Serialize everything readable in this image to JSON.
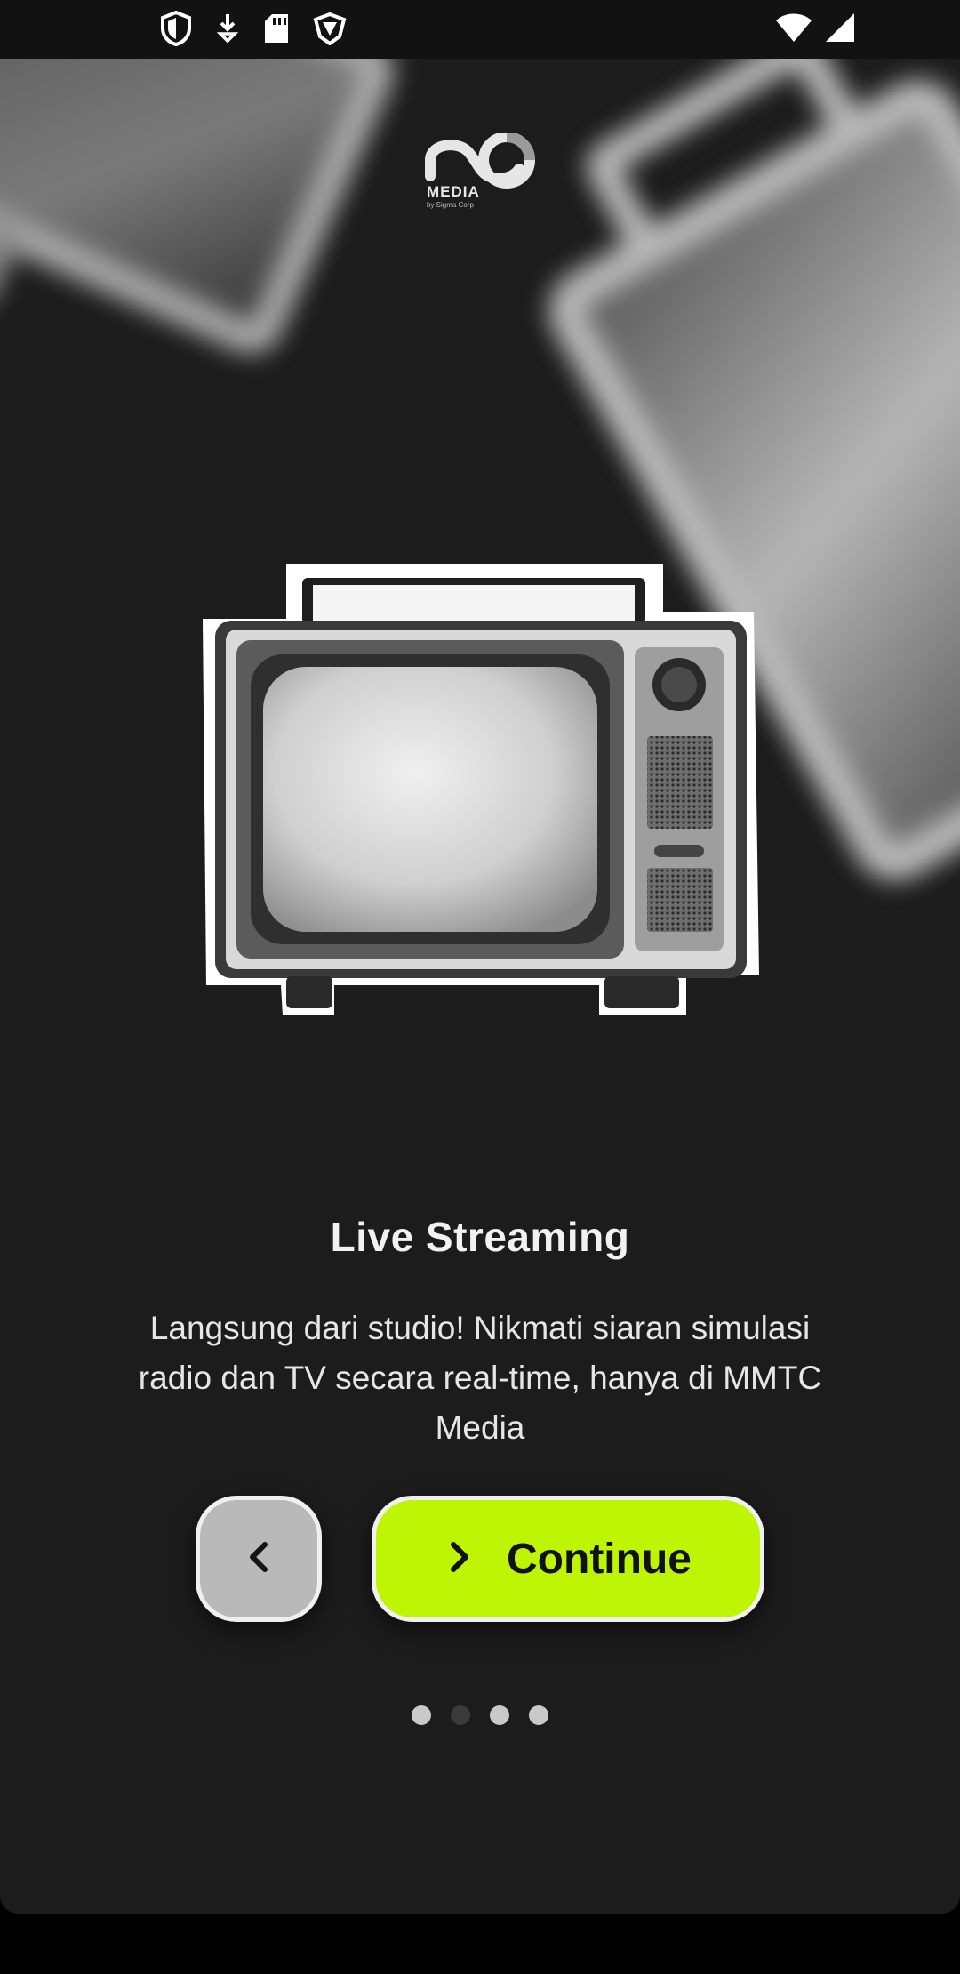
{
  "status_bar": {
    "left_icons": [
      "shield-icon",
      "download-icon",
      "sd-card-icon",
      "vpn-shield-icon"
    ],
    "right_icons": [
      "wifi-icon",
      "cell-signal-icon"
    ]
  },
  "logo": {
    "text": "MEDIA",
    "subtext": "by Sigma Corp"
  },
  "onboarding": {
    "title": "Live Streaming",
    "description": "Langsung dari studio! Nikmati siaran simulasi radio dan TV secara real-time, hanya di MMTC Media",
    "back_icon": "chevron-left-icon",
    "continue_icon": "chevron-right-icon",
    "continue_label": "Continue",
    "page_count": 4,
    "current_page": 2
  },
  "colors": {
    "background": "#1c1c1d",
    "accent": "#bef505",
    "back_button": "#b9b9b9"
  }
}
